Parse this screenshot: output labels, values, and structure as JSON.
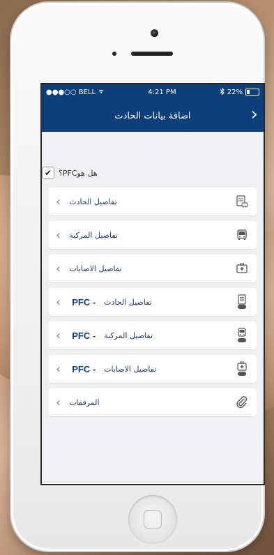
{
  "status": {
    "carrier": "●●●○○ BELL",
    "wifi": "wifi-icon",
    "time": "4:21 PM",
    "bluetooth": "bluetooth-icon",
    "battery": "22%",
    "battery_level": 0.22
  },
  "nav": {
    "title": "اضافة بيانات الحادث",
    "forward": "›"
  },
  "question": {
    "text": "هل هوPFC؟",
    "checked": "✔"
  },
  "items": [
    {
      "label": "تفاصيل الحادث",
      "pfc": "",
      "icon": "accident-report-icon"
    },
    {
      "label": "تفاصيل المركبة",
      "pfc": "",
      "icon": "bus-icon"
    },
    {
      "label": "تفاصيل الاصابات",
      "pfc": "",
      "icon": "first-aid-icon"
    },
    {
      "label": "تفاصيل الحادث",
      "pfc": "PFC -",
      "icon": "pfc-document-icon"
    },
    {
      "label": "تفاصيل المركبة",
      "pfc": "PFC -",
      "icon": "pfc-bus-icon"
    },
    {
      "label": "تفاصيل الاصابات",
      "pfc": "PFC -",
      "icon": "pfc-first-aid-icon"
    },
    {
      "label": "المرفقات",
      "pfc": "",
      "icon": "paperclip-icon"
    }
  ]
}
